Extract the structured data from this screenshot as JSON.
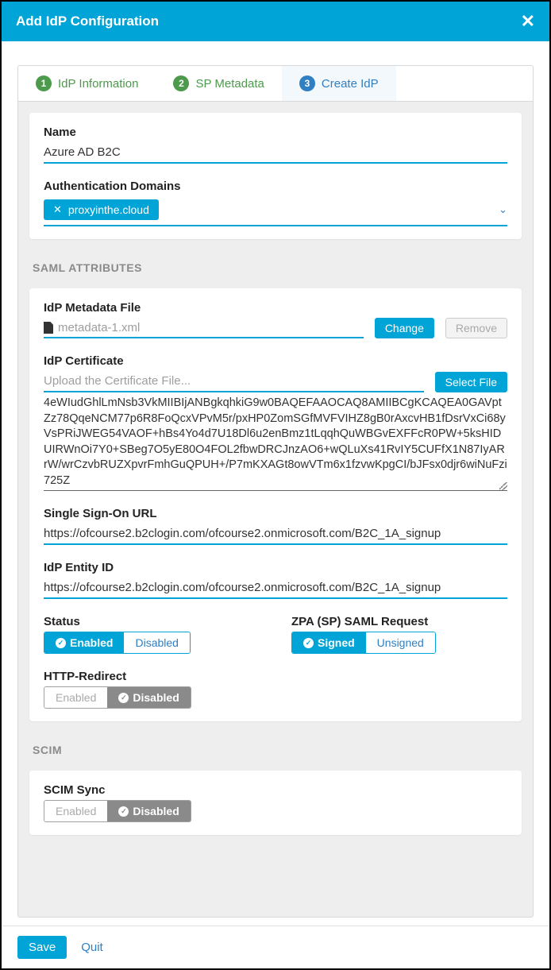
{
  "dialog": {
    "title": "Add IdP Configuration"
  },
  "stepper": {
    "steps": [
      {
        "num": "1",
        "label": "IdP Information"
      },
      {
        "num": "2",
        "label": "SP Metadata"
      },
      {
        "num": "3",
        "label": "Create IdP"
      }
    ]
  },
  "general": {
    "name_label": "Name",
    "name_value": "Azure AD B2C",
    "auth_domains_label": "Authentication Domains",
    "auth_domain_chip": "proxyinthe.cloud"
  },
  "saml": {
    "section_label": "SAML ATTRIBUTES",
    "metadata_label": "IdP Metadata File",
    "metadata_filename": "metadata-1.xml",
    "change_label": "Change",
    "remove_label": "Remove",
    "cert_label": "IdP Certificate",
    "cert_placeholder": "Upload the Certificate File...",
    "select_file_label": "Select File",
    "cert_text": "4eWIudGhlLmNsb3VkMIIBIjANBgkqhkiG9w0BAQEFAAOCAQ8AMIIBCgKCAQEA0GAVptZz78QqeNCM77p6R8FoQcxVPvM5r/pxHP0ZomSGfMVFVIHZ8gB0rAxcvHB1fDsrVxCi68yVsPRiJWEG54VAOF+hBs4Yo4d7U18Dl6u2enBmz1tLqqhQuWBGvEXFFcR0PW+5ksHIDUIRWnOi7Y0+SBeg7O5yE80O4FOL2fbwDRCJnzAO6+wQLuXs41RvIY5CUFfX1N87IyARrW/wrCzvbRUZXpvrFmhGuQPUH+/P7mKXAGt8owVTm6x1fzvwKpgCI/bJFsx0djr6wiNuFzi725Z",
    "sso_label": "Single Sign-On URL",
    "sso_value": "https://ofcourse2.b2clogin.com/ofcourse2.onmicrosoft.com/B2C_1A_signup",
    "entity_label": "IdP Entity ID",
    "entity_value": "https://ofcourse2.b2clogin.com/ofcourse2.onmicrosoft.com/B2C_1A_signup",
    "status_label": "Status",
    "status_enabled": "Enabled",
    "status_disabled": "Disabled",
    "zpa_label": "ZPA (SP) SAML Request",
    "zpa_signed": "Signed",
    "zpa_unsigned": "Unsigned",
    "http_label": "HTTP-Redirect",
    "http_enabled": "Enabled",
    "http_disabled": "Disabled"
  },
  "scim": {
    "section_label": "SCIM",
    "sync_label": "SCIM Sync",
    "enabled": "Enabled",
    "disabled": "Disabled"
  },
  "footer": {
    "save": "Save",
    "quit": "Quit"
  }
}
